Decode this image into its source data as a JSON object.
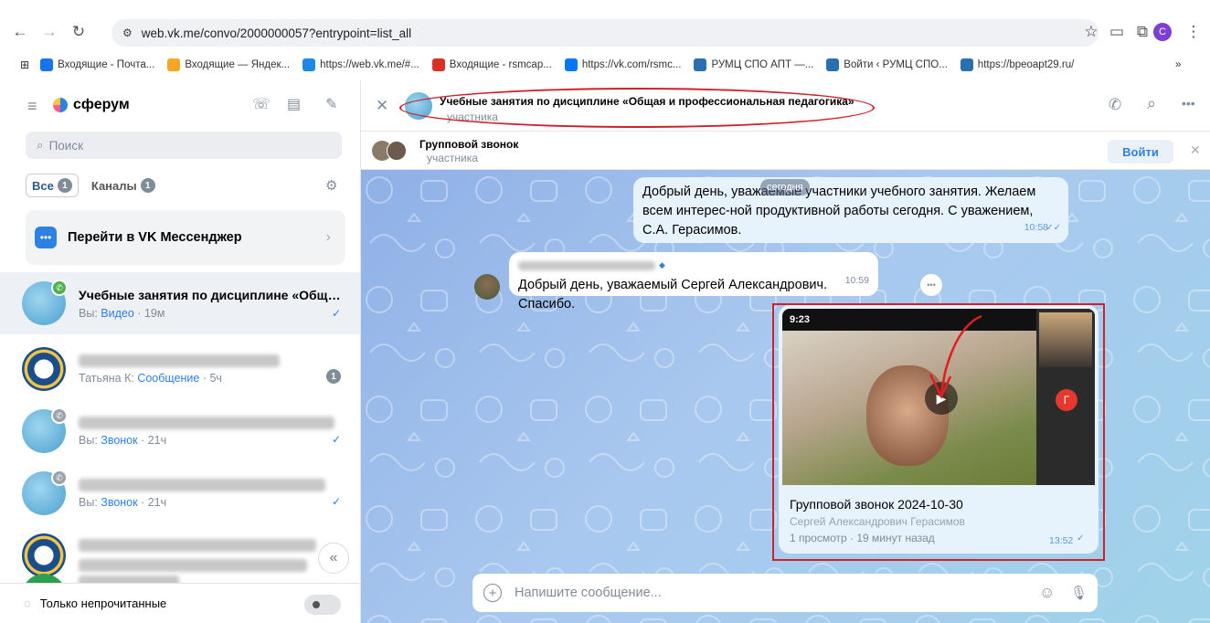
{
  "browser": {
    "url": "web.vk.me/convo/2000000057?entrypoint=list_all",
    "bookmarks": [
      {
        "label": "Входящие - Почта...",
        "color": "#1a73e8"
      },
      {
        "label": "Входящие — Яндек...",
        "color": "#f5a623"
      },
      {
        "label": "https://web.vk.me/#...",
        "color": "#1e88e5"
      },
      {
        "label": "Входящие - rsmcap...",
        "color": "#d93025"
      },
      {
        "label": "https://vk.com/rsmc...",
        "color": "#0077ff"
      },
      {
        "label": "РУМЦ СПО АПТ —...",
        "color": "#2a6fb0"
      },
      {
        "label": "Войти ‹ РУМЦ СПО...",
        "color": "#2a6fb0"
      },
      {
        "label": "https://bpeoapt29.ru/",
        "color": "#2a6fb0"
      }
    ],
    "more_bookmarks": "»",
    "profile_initial": "С"
  },
  "sidebar": {
    "brand": "сферум",
    "search_placeholder": "Поиск",
    "filters": [
      {
        "label": "Все",
        "count": "1"
      },
      {
        "label": "Каналы",
        "count": "1"
      }
    ],
    "vk_messenger_label": "Перейти в VK Мессенджер",
    "chats": [
      {
        "title": "Учебные занятия по дисциплине «Обща...",
        "prefix": "Вы:",
        "link": "Видео",
        "time": "· 19м"
      },
      {
        "title": "",
        "prefix": "Татьяна К:",
        "link": "Сообщение",
        "time": "· 5ч",
        "unread": "1"
      },
      {
        "title": "",
        "prefix": "Вы:",
        "link": "Звонок",
        "time": "· 21ч"
      },
      {
        "title": "",
        "prefix": "Вы:",
        "link": "Звонок",
        "time": "· 21ч"
      }
    ],
    "unread_only_label": "Только непрочитанные",
    "collapse_glyph": "«"
  },
  "conversation": {
    "title": "Учебные занятия по дисциплине «Общая и профессиональная педагогика»",
    "subtitle": "участника",
    "call": {
      "title": "Групповой звонок",
      "subtitle": "участника",
      "join_label": "Войти"
    },
    "date_label": "сегодня",
    "messages": [
      {
        "text": "Добрый день, уважаемые участники учебного занятия. Желаем всем интерес-ной продуктивной работы сегодня. С уважением, С.А. Герасимов.",
        "time": "10:58"
      },
      {
        "text": "Добрый день, уважаемый Сергей Александрович. Спасибо.",
        "time": "10:59"
      }
    ],
    "video": {
      "duration": "9:23",
      "title": "Групповой звонок 2024-10-30",
      "author": "Сергей Александрович Герасимов",
      "stats": "1 просмотр · 19 минут назад",
      "time": "13:52",
      "side_avatar_letter": "Г"
    },
    "composer_placeholder": "Напишите сообщение..."
  },
  "colors": {
    "accent": "#2d81e0",
    "highlight": "#d0202a"
  }
}
